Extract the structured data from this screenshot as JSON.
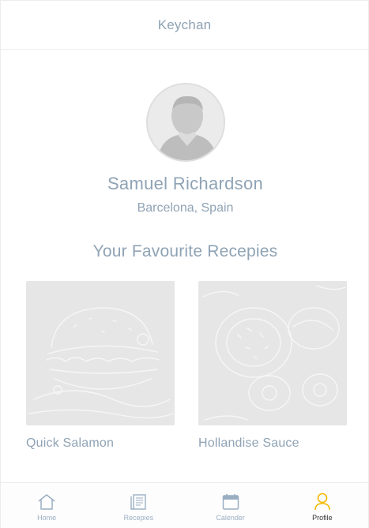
{
  "header": {
    "title": "Keychan"
  },
  "profile": {
    "name": "Samuel Richardson",
    "location": "Barcelona, Spain"
  },
  "favourites": {
    "title": "Your Favourite Recepies",
    "items": [
      {
        "label": "Quick Salamon",
        "image": "burger-sketch"
      },
      {
        "label": "Hollandise Sauce",
        "image": "bowl-sketch"
      }
    ]
  },
  "tabbar": {
    "tabs": [
      {
        "label": "Home",
        "icon": "home-icon",
        "active": false
      },
      {
        "label": "Recepies",
        "icon": "book-icon",
        "active": false
      },
      {
        "label": "Calender",
        "icon": "calendar-icon",
        "active": false
      },
      {
        "label": "Profile",
        "icon": "person-icon",
        "active": true
      }
    ]
  },
  "colors": {
    "text": "#8fa3b5",
    "tab_inactive": "#9aaec2",
    "tab_active_icon": "#f5b800",
    "tab_active_label": "#333333"
  }
}
